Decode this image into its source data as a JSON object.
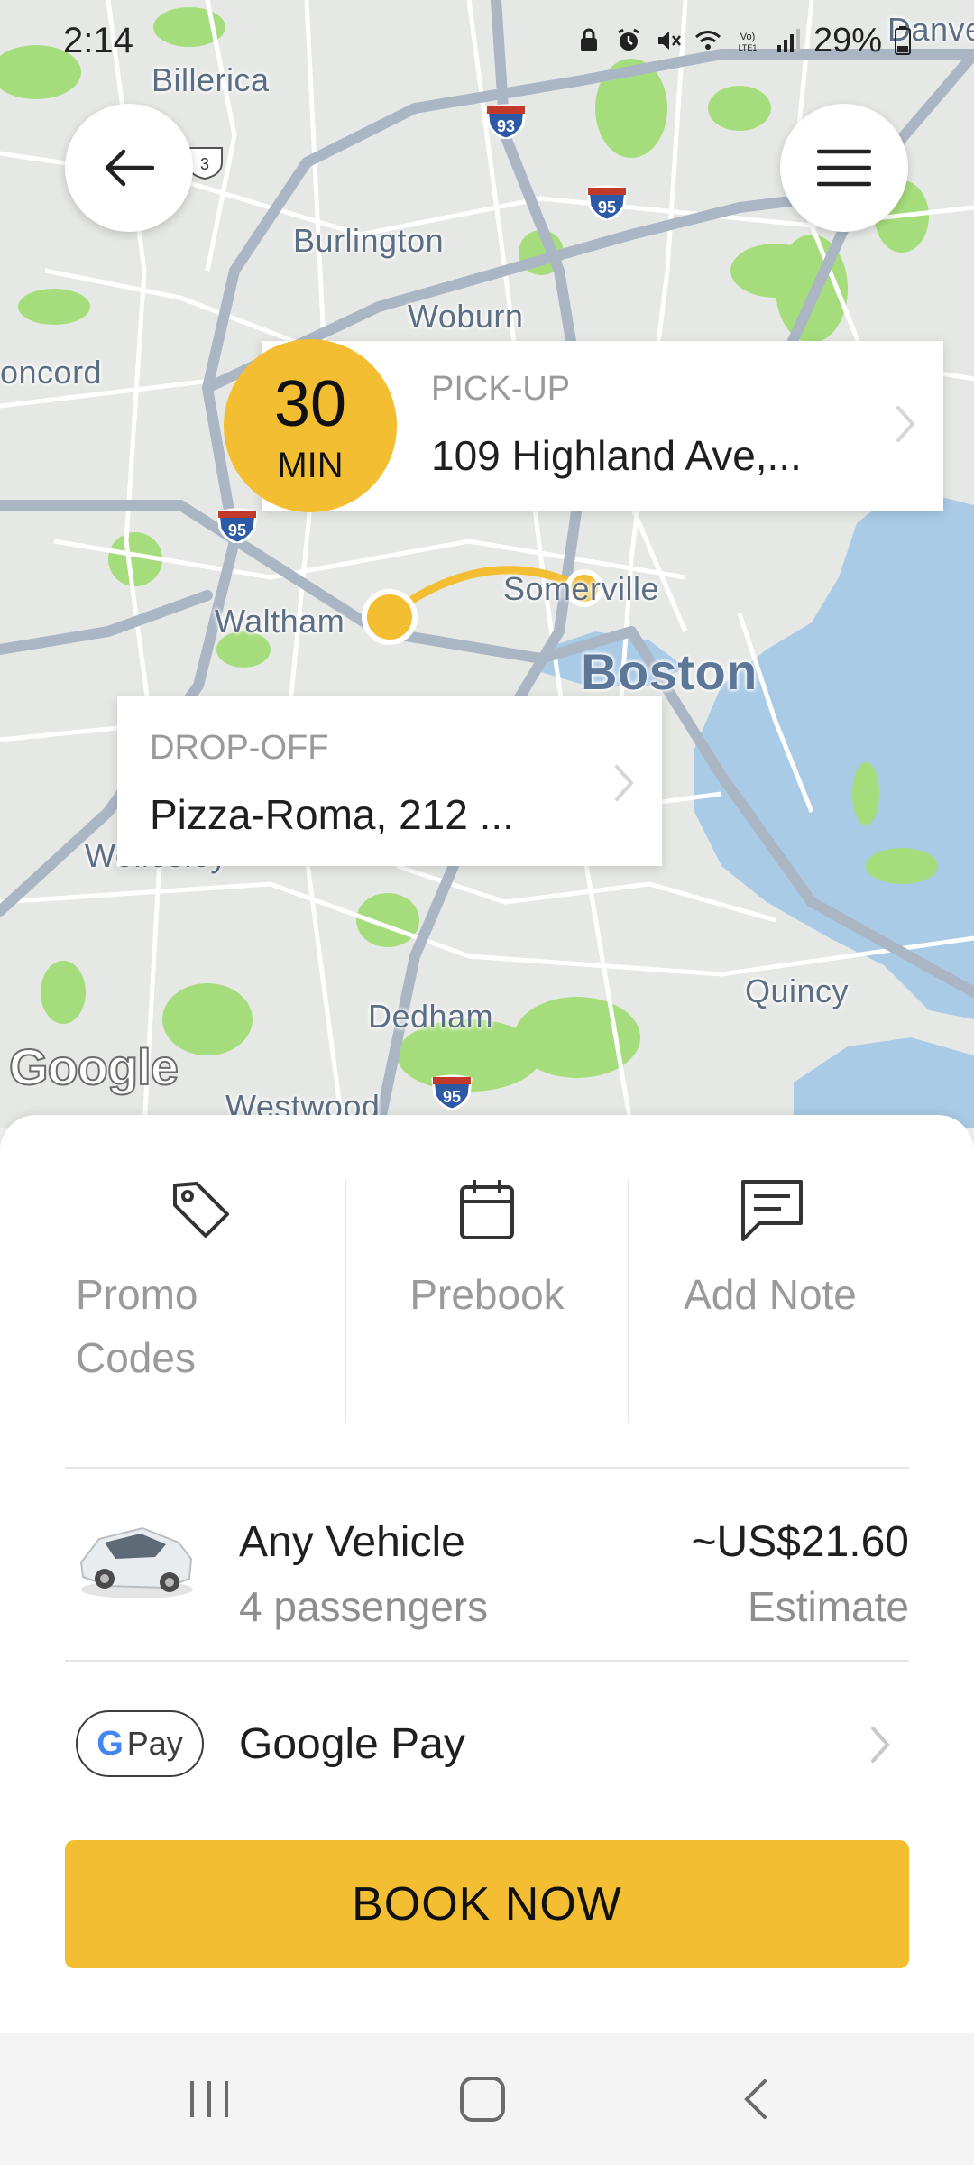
{
  "status_bar": {
    "time": "2:14",
    "battery": "29%"
  },
  "map": {
    "places": {
      "billerica": "Billerica",
      "burlington": "Burlington",
      "woburn": "Woburn",
      "concord": "oncord",
      "waltham": "Waltham",
      "somerville": "Somerville",
      "boston": "Boston",
      "wellesley": "Wellesley",
      "quincy": "Quincy",
      "dedham": "Dedham",
      "westwood": "Westwood",
      "danvers": "Danve"
    },
    "highway_shields": [
      "93",
      "95",
      "95",
      "95",
      "3"
    ],
    "attribution": "Google"
  },
  "trip": {
    "eta_value": "30",
    "eta_unit": "MIN",
    "pickup_label": "PICK-UP",
    "pickup_address": "109 Highland Ave,...",
    "dropoff_label": "DROP-OFF",
    "dropoff_address": "Pizza-Roma, 212 ..."
  },
  "options": {
    "promo": {
      "label": "Promo Codes",
      "icon": "tag-icon"
    },
    "prebook": {
      "label": "Prebook",
      "icon": "calendar-icon"
    },
    "note": {
      "label": "Add Note",
      "icon": "message-icon"
    }
  },
  "vehicle": {
    "name": "Any Vehicle",
    "capacity": "4 passengers",
    "price": "~US$21.60",
    "price_note": "Estimate"
  },
  "payment": {
    "chip_g": "G",
    "chip_text": "Pay",
    "method": "Google Pay"
  },
  "actions": {
    "book": "BOOK NOW"
  },
  "colors": {
    "accent": "#f3be31",
    "water": "#aacbe6",
    "park": "#a6dd7c",
    "road": "#ffffff",
    "highway": "#aab6c4"
  }
}
